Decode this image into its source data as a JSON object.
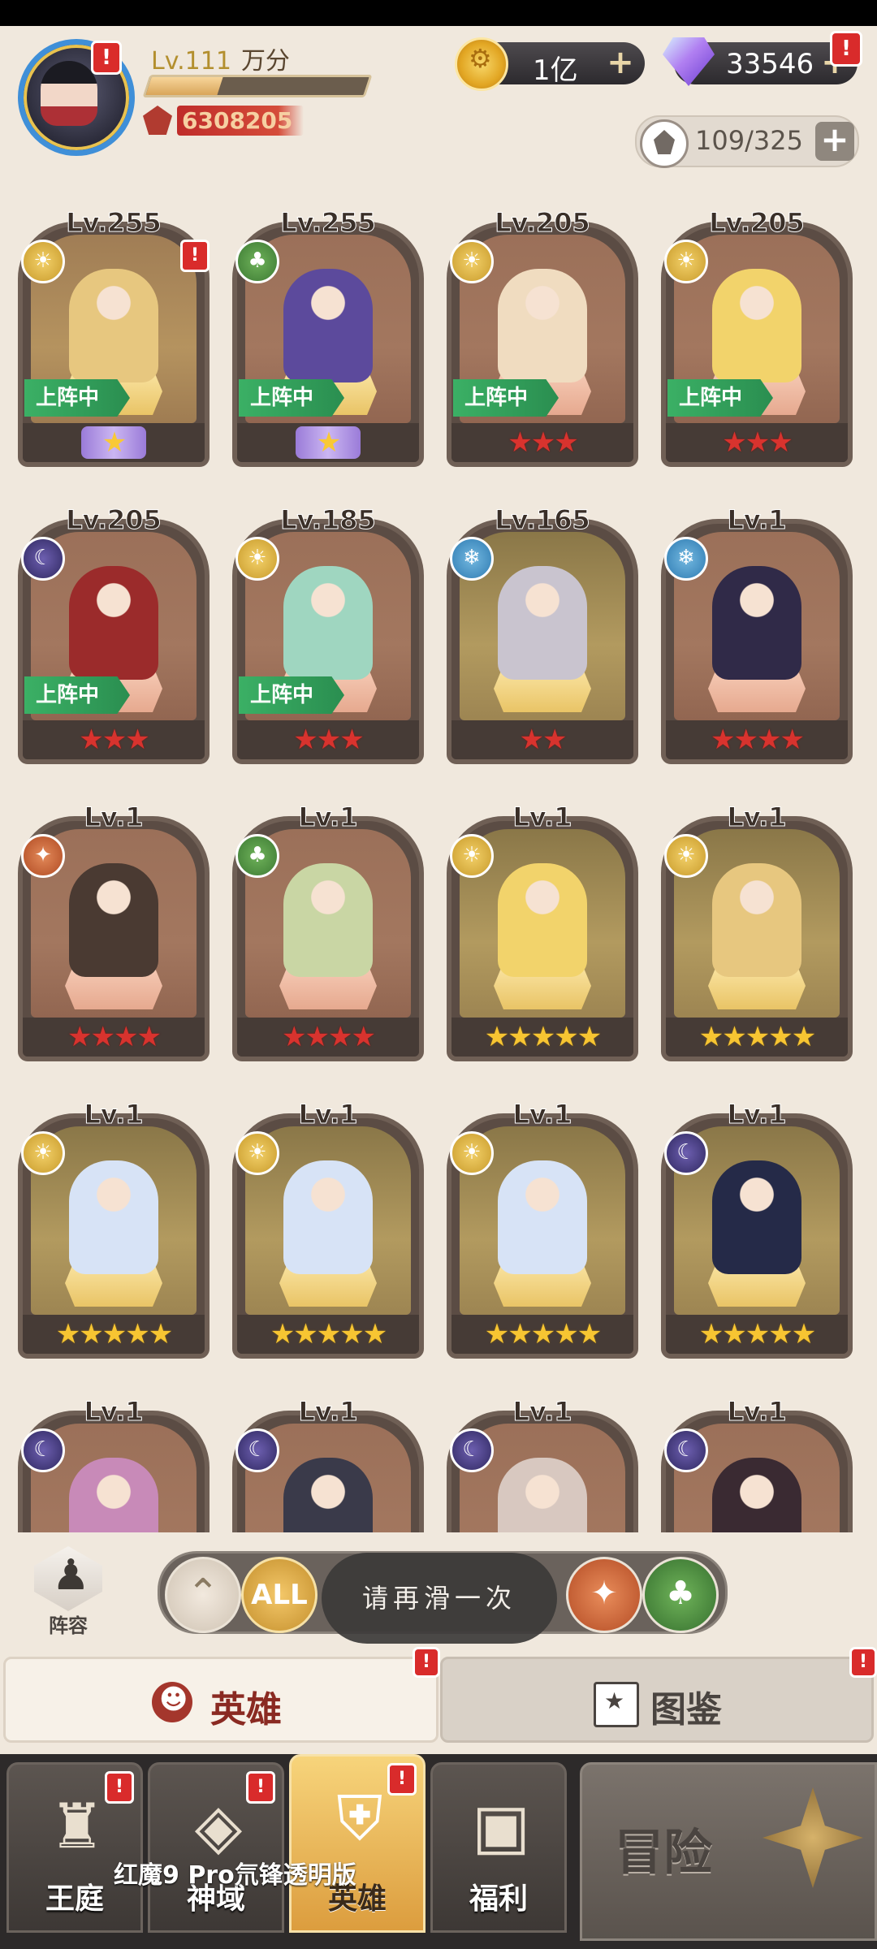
{
  "profile": {
    "level": "Lv.111",
    "name": "万分",
    "xp_fraction": 0.33,
    "power": "6308205",
    "alert": "!"
  },
  "currencies": {
    "gold": "1亿",
    "gems": "33546",
    "plus": "+",
    "alert": "!"
  },
  "capacity": {
    "value": "109/325",
    "plus": "+"
  },
  "heroes": [
    {
      "level": "Lv.255",
      "faction": "light",
      "faction_icon": "sun-icon",
      "on_team": true,
      "stars": 1,
      "star_style": "purple",
      "alert": true,
      "bg": "tan",
      "pedestal": "gold",
      "fig": "#e7c77f"
    },
    {
      "level": "Lv.255",
      "faction": "forest",
      "faction_icon": "tree-icon",
      "on_team": true,
      "stars": 1,
      "star_style": "purple",
      "alert": false,
      "bg": "brown",
      "pedestal": "gold",
      "fig": "#5c4a9c"
    },
    {
      "level": "Lv.205",
      "faction": "light",
      "faction_icon": "sun-icon",
      "on_team": true,
      "stars": 3,
      "star_style": "red",
      "alert": false,
      "bg": "brown",
      "pedestal": "pink",
      "fig": "#f0dcc0"
    },
    {
      "level": "Lv.205",
      "faction": "light",
      "faction_icon": "sun-icon",
      "on_team": true,
      "stars": 3,
      "star_style": "red",
      "alert": false,
      "bg": "brown",
      "pedestal": "pink",
      "fig": "#f2d36b"
    },
    {
      "level": "Lv.205",
      "faction": "dark",
      "faction_icon": "moon-icon",
      "on_team": true,
      "stars": 3,
      "star_style": "red",
      "alert": false,
      "bg": "brown",
      "pedestal": "pink",
      "fig": "#9b2b2b"
    },
    {
      "level": "Lv.185",
      "faction": "light",
      "faction_icon": "sun-icon",
      "on_team": true,
      "stars": 3,
      "star_style": "red",
      "alert": false,
      "bg": "brown",
      "pedestal": "pink",
      "fig": "#9fd6c0"
    },
    {
      "level": "Lv.165",
      "faction": "water",
      "faction_icon": "ice-icon",
      "on_team": false,
      "stars": 2,
      "star_style": "red",
      "alert": false,
      "bg": "gold",
      "pedestal": "gold",
      "fig": "#c9c4cf"
    },
    {
      "level": "Lv.1",
      "faction": "water",
      "faction_icon": "ice-icon",
      "on_team": false,
      "stars": 4,
      "star_style": "red",
      "alert": false,
      "bg": "brown",
      "pedestal": "pink",
      "fig": "#302a48"
    },
    {
      "level": "Lv.1",
      "faction": "fire",
      "faction_icon": "wolf-icon",
      "on_team": false,
      "stars": 4,
      "star_style": "red",
      "alert": false,
      "bg": "brown",
      "pedestal": "pink",
      "fig": "#4a3a32"
    },
    {
      "level": "Lv.1",
      "faction": "forest",
      "faction_icon": "tree-icon",
      "on_team": false,
      "stars": 4,
      "star_style": "red",
      "alert": false,
      "bg": "brown",
      "pedestal": "pink",
      "fig": "#c9d6a4"
    },
    {
      "level": "Lv.1",
      "faction": "light",
      "faction_icon": "sun-icon",
      "on_team": false,
      "stars": 5,
      "star_style": "gold",
      "alert": false,
      "bg": "gold",
      "pedestal": "gold",
      "fig": "#f2d36b"
    },
    {
      "level": "Lv.1",
      "faction": "light",
      "faction_icon": "sun-icon",
      "on_team": false,
      "stars": 5,
      "star_style": "gold",
      "alert": false,
      "bg": "gold",
      "pedestal": "gold",
      "fig": "#e7c77f"
    },
    {
      "level": "Lv.1",
      "faction": "light",
      "faction_icon": "sun-icon",
      "on_team": false,
      "stars": 5,
      "star_style": "gold",
      "alert": false,
      "bg": "gold",
      "pedestal": "gold",
      "fig": "#d7e3f6"
    },
    {
      "level": "Lv.1",
      "faction": "light",
      "faction_icon": "sun-icon",
      "on_team": false,
      "stars": 5,
      "star_style": "gold",
      "alert": false,
      "bg": "gold",
      "pedestal": "gold",
      "fig": "#d7e3f6"
    },
    {
      "level": "Lv.1",
      "faction": "light",
      "faction_icon": "sun-icon",
      "on_team": false,
      "stars": 5,
      "star_style": "gold",
      "alert": false,
      "bg": "gold",
      "pedestal": "gold",
      "fig": "#d7e3f6"
    },
    {
      "level": "Lv.1",
      "faction": "dark",
      "faction_icon": "moon-icon",
      "on_team": false,
      "stars": 5,
      "star_style": "gold",
      "alert": false,
      "bg": "gold",
      "pedestal": "gold",
      "fig": "#252a48"
    },
    {
      "level": "Lv.1",
      "faction": "dark",
      "faction_icon": "moon-icon",
      "on_team": false,
      "stars": 0,
      "star_style": "gold",
      "alert": false,
      "bg": "brown",
      "pedestal": "pink",
      "fig": "#c88ab8"
    },
    {
      "level": "Lv.1",
      "faction": "dark",
      "faction_icon": "moon-icon",
      "on_team": false,
      "stars": 0,
      "star_style": "gold",
      "alert": false,
      "bg": "brown",
      "pedestal": "pink",
      "fig": "#3a3a4a"
    },
    {
      "level": "Lv.1",
      "faction": "dark",
      "faction_icon": "moon-icon",
      "on_team": false,
      "stars": 0,
      "star_style": "gold",
      "alert": false,
      "bg": "brown",
      "pedestal": "pink",
      "fig": "#d8c8c0"
    },
    {
      "level": "Lv.1",
      "faction": "dark",
      "faction_icon": "moon-icon",
      "on_team": false,
      "stars": 0,
      "star_style": "gold",
      "alert": false,
      "bg": "brown",
      "pedestal": "pink",
      "fig": "#3a2a32"
    }
  ],
  "on_team_label": "上阵中",
  "filters": {
    "lineup_label": "阵容",
    "all_label": "ALL",
    "options": [
      "up-arrow-icon",
      "all",
      "wolf-icon",
      "tree-icon"
    ]
  },
  "toast": "请再滑一次",
  "tabs": {
    "heroes": "英雄",
    "codex": "图鉴",
    "alert": "!"
  },
  "nav": {
    "items": [
      {
        "label": "王庭",
        "icon": "castle-icon",
        "alert": true
      },
      {
        "label": "神域",
        "icon": "crystal-icon",
        "alert": true
      },
      {
        "label": "英雄",
        "icon": "helmet-icon",
        "alert": true,
        "active": true
      },
      {
        "label": "福利",
        "icon": "chest-icon",
        "alert": false
      }
    ],
    "adventure": "冒险"
  },
  "watermark": "红魔9 Pro氘锋透明版",
  "colors": {
    "on_team": "#2a8e50",
    "alert": "#d92b2b",
    "gold_accent": "#e2a623"
  }
}
